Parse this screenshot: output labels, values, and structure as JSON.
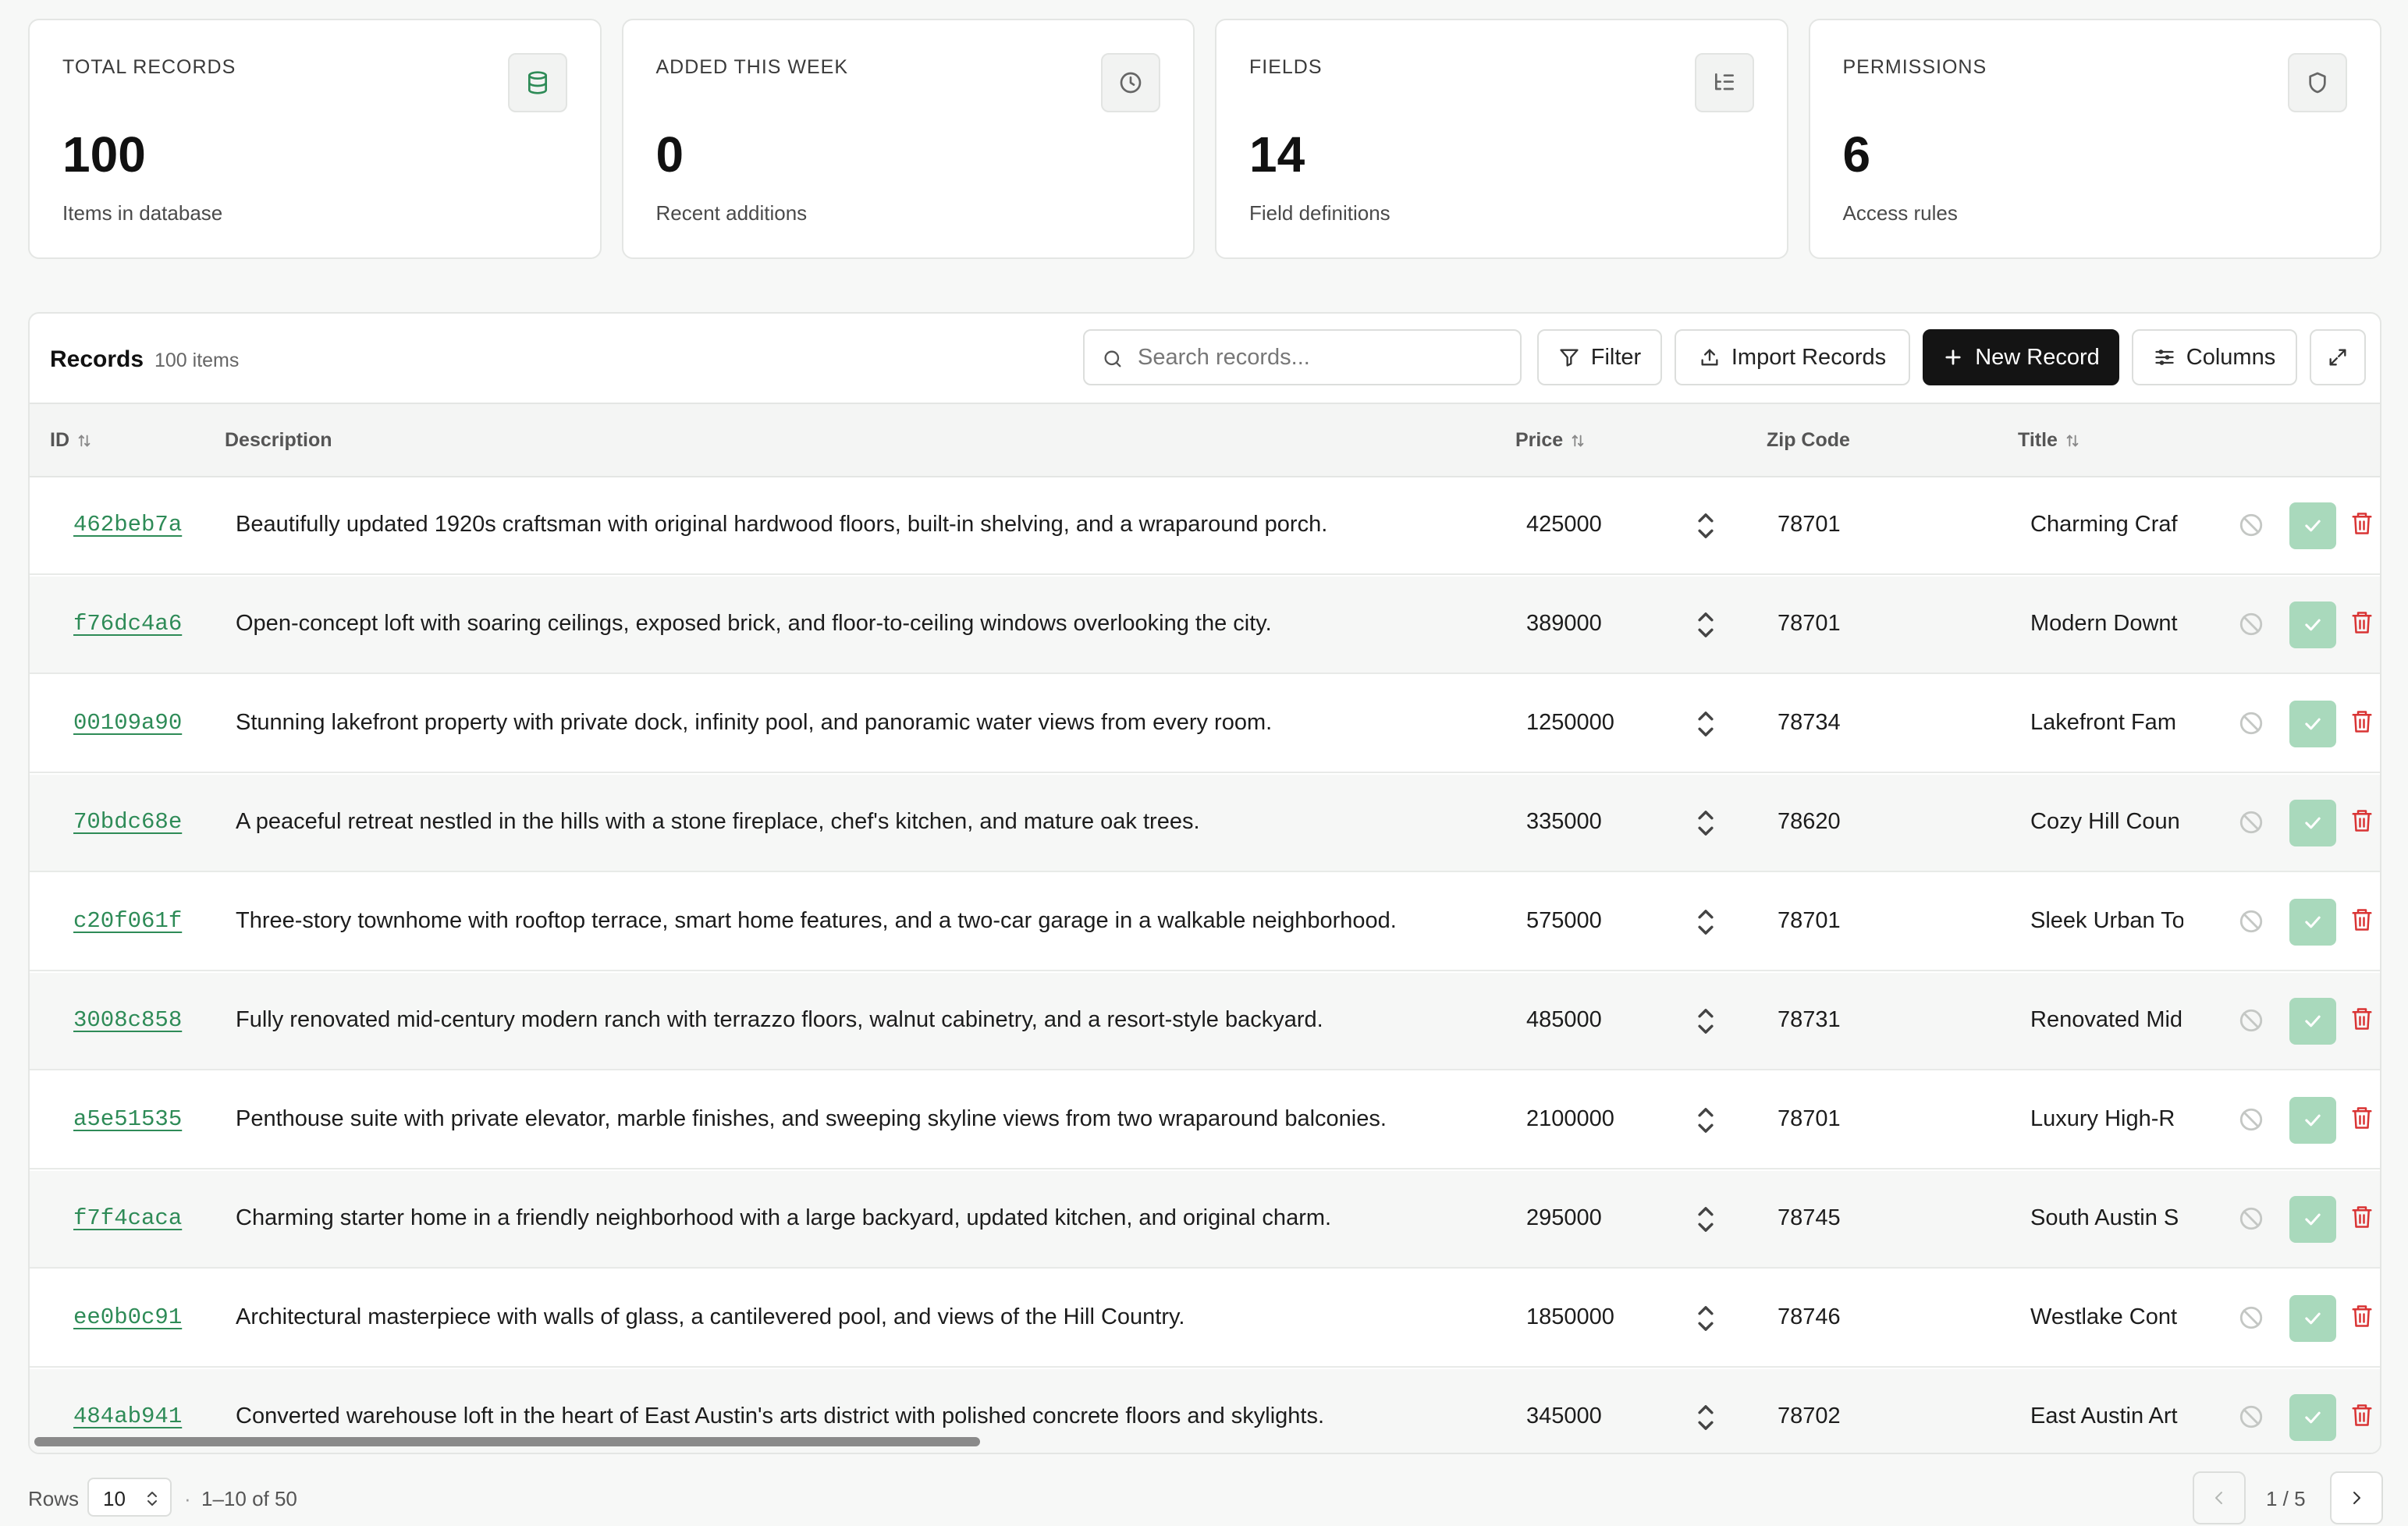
{
  "stats": [
    {
      "label": "TOTAL RECORDS",
      "value": "100",
      "sub": "Items in database",
      "icon": "database-icon"
    },
    {
      "label": "ADDED THIS WEEK",
      "value": "0",
      "sub": "Recent additions",
      "icon": "clock-icon"
    },
    {
      "label": "FIELDS",
      "value": "14",
      "sub": "Field definitions",
      "icon": "list-tree-icon"
    },
    {
      "label": "PERMISSIONS",
      "value": "6",
      "sub": "Access rules",
      "icon": "shield-icon"
    }
  ],
  "toolbar": {
    "title": "Records",
    "count": "100 items",
    "search_placeholder": "Search records...",
    "filter_label": "Filter",
    "import_label": "Import Records",
    "new_label": "New Record",
    "columns_label": "Columns"
  },
  "columns": {
    "id": "ID",
    "description": "Description",
    "price": "Price",
    "zip": "Zip Code",
    "title": "Title"
  },
  "rows": [
    {
      "id": "462beb7a",
      "description": "Beautifully updated 1920s craftsman with original hardwood floors, built-in shelving, and a wraparound porch.",
      "price": "425000",
      "zip": "78701",
      "title": "Charming Craf"
    },
    {
      "id": "f76dc4a6",
      "description": "Open-concept loft with soaring ceilings, exposed brick, and floor-to-ceiling windows overlooking the city.",
      "price": "389000",
      "zip": "78701",
      "title": "Modern Downt"
    },
    {
      "id": "00109a90",
      "description": "Stunning lakefront property with private dock, infinity pool, and panoramic water views from every room.",
      "price": "1250000",
      "zip": "78734",
      "title": "Lakefront Fam"
    },
    {
      "id": "70bdc68e",
      "description": "A peaceful retreat nestled in the hills with a stone fireplace, chef's kitchen, and mature oak trees.",
      "price": "335000",
      "zip": "78620",
      "title": "Cozy Hill Coun"
    },
    {
      "id": "c20f061f",
      "description": "Three-story townhome with rooftop terrace, smart home features, and a two-car garage in a walkable neighborhood.",
      "price": "575000",
      "zip": "78701",
      "title": "Sleek Urban To"
    },
    {
      "id": "3008c858",
      "description": "Fully renovated mid-century modern ranch with terrazzo floors, walnut cabinetry, and a resort-style backyard.",
      "price": "485000",
      "zip": "78731",
      "title": "Renovated Mid"
    },
    {
      "id": "a5e51535",
      "description": "Penthouse suite with private elevator, marble finishes, and sweeping skyline views from two wraparound balconies.",
      "price": "2100000",
      "zip": "78701",
      "title": "Luxury High-R"
    },
    {
      "id": "f7f4caca",
      "description": "Charming starter home in a friendly neighborhood with a large backyard, updated kitchen, and original charm.",
      "price": "295000",
      "zip": "78745",
      "title": "South Austin S"
    },
    {
      "id": "ee0b0c91",
      "description": "Architectural masterpiece with walls of glass, a cantilevered pool, and views of the Hill Country.",
      "price": "1850000",
      "zip": "78746",
      "title": "Westlake Cont"
    },
    {
      "id": "484ab941",
      "description": "Converted warehouse loft in the heart of East Austin's arts district with polished concrete floors and skylights.",
      "price": "345000",
      "zip": "78702",
      "title": "East Austin Art"
    }
  ],
  "footer": {
    "rows_label": "Rows",
    "rows_value": "10",
    "separator": "·",
    "range": "1–10 of 50",
    "page": "1 / 5"
  }
}
